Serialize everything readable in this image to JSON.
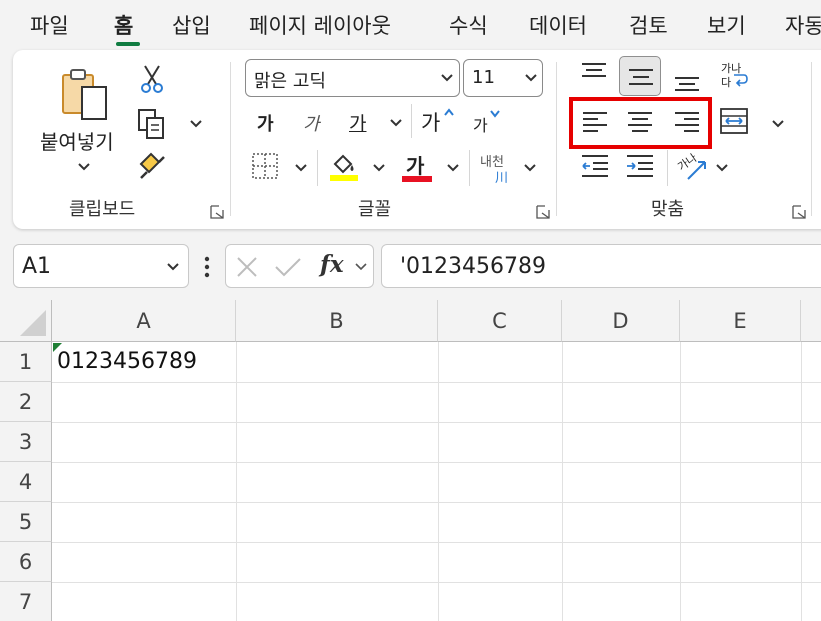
{
  "ribbon_tabs": [
    {
      "label": "파일",
      "active": false
    },
    {
      "label": "홈",
      "active": true
    },
    {
      "label": "삽입",
      "active": false
    },
    {
      "label": "페이지 레이아웃",
      "active": false
    },
    {
      "label": "수식",
      "active": false
    },
    {
      "label": "데이터",
      "active": false
    },
    {
      "label": "검토",
      "active": false
    },
    {
      "label": "보기",
      "active": false
    },
    {
      "label": "자동",
      "active": false
    }
  ],
  "clipboard": {
    "paste_label": "붙여넣기",
    "group_label": "클립보드",
    "icons": [
      "paste-icon",
      "cut-icon",
      "copy-icon",
      "format-painter-icon"
    ]
  },
  "font": {
    "font_name": "맑은 고딕",
    "font_size": "11",
    "bold_glyph": "가",
    "italic_glyph": "가",
    "underline_glyph": "가",
    "grow_glyph": "가",
    "shrink_glyph": "가",
    "font_color_glyph": "가",
    "phonetic_top": "내천",
    "phonetic_bottom": "川",
    "group_label": "글꼴",
    "fill_color": "#ffff00",
    "font_color": "#e81123"
  },
  "alignment": {
    "wrap_top": "가나",
    "wrap_bottom": "다",
    "orientation_glyph": "가나",
    "group_label": "맞춤",
    "icons": [
      "align-top-icon",
      "align-middle-icon",
      "align-bottom-icon",
      "wrap-text-icon",
      "align-left-icon",
      "align-center-icon",
      "align-right-icon",
      "merge-center-icon",
      "decrease-indent-icon",
      "increase-indent-icon",
      "orientation-icon"
    ],
    "highlight_color": "#e60000"
  },
  "formula_bar": {
    "name_box": "A1",
    "fx_label": "fx",
    "formula": "'0123456789"
  },
  "sheet": {
    "columns": [
      "A",
      "B",
      "C",
      "D",
      "E"
    ],
    "rows": [
      "1",
      "2",
      "3",
      "4",
      "5",
      "6",
      "7"
    ],
    "cells": {
      "A1": "0123456789"
    }
  },
  "colors": {
    "accent": "#107c41",
    "error_indicator": "#1e7e34"
  }
}
